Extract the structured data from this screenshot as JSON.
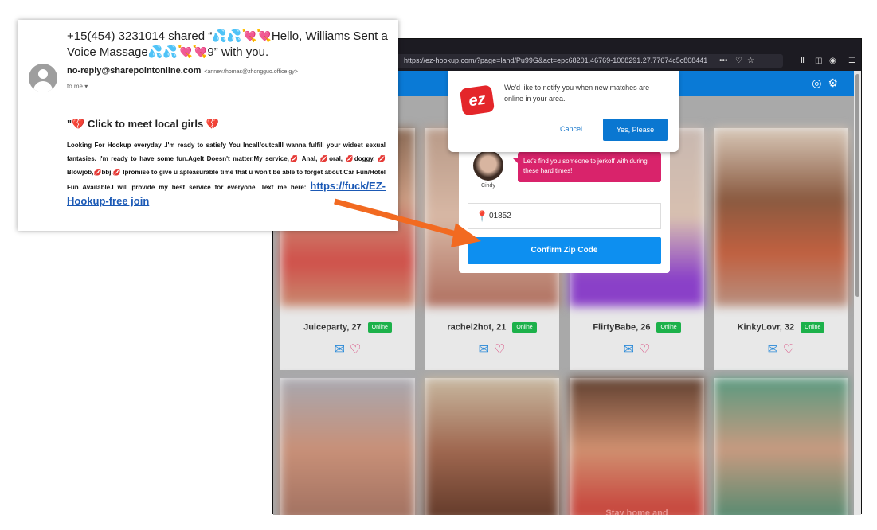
{
  "browser": {
    "url": "https://ez-hookup.com/?page=land/Pu99G&act=epc68201.46769-1008291.27.77674c5c808441",
    "toolbar_icons": [
      "more-icon",
      "pocket-icon",
      "star-icon",
      "library-icon",
      "sidebar-icon",
      "account-icon",
      "menu-icon"
    ]
  },
  "site": {
    "header_icons": [
      "user-icon",
      "gear-icon"
    ],
    "brand_color": "#0a7ad6",
    "notification": {
      "logo": "ez",
      "text": "We'd like to notify you when new matches are online in your area.",
      "cancel": "Cancel",
      "accept": "Yes, Please"
    },
    "zip_modal": {
      "agent_name": "Cindy",
      "message": "Let's find you someone to jerkoff with during these hard times!",
      "zip_value": "01852",
      "confirm": "Confirm Zip Code"
    },
    "profiles": [
      {
        "name": "Juiceparty, 27",
        "status": "Online"
      },
      {
        "name": "rachel2hot, 21",
        "status": "Online"
      },
      {
        "name": "FlirtyBabe, 26",
        "status": "Online"
      },
      {
        "name": "KinkyLovr, 32",
        "status": "Online"
      }
    ],
    "blurred_banner": "Stay home and"
  },
  "email": {
    "subject": "+15(454) 3231014 shared “💦💦💘💘Hello, Williams Sent a Voice Massage💦💦💘💘9” with you.",
    "from_name": "no-reply@sharepointonline.com",
    "from_address": "<annev.thomas@zhongguo.office.gy>",
    "to": "to me",
    "heading": "\"💔 Click to meet local girls 💔",
    "body": "Looking For Hookup everyday .I'm ready to satisfy You Incall/outcallI wanna fulfill your widest sexual fantasies. I'm ready to have some fun.AgeIt Doesn't matter.My service,💋 Anal, 💋oral, 💋doggy, 💋Blowjob,💋bbj.💋 Ipromise to give u apleasurable time that u won't be able to forget about.Car Fun/Hotel Fun Available.I will provide my best service for everyone.  Text me here: ",
    "link": "https://fuck/EZ-Hookup-free join"
  },
  "annotation": {
    "arrow_color": "#f26a21"
  }
}
